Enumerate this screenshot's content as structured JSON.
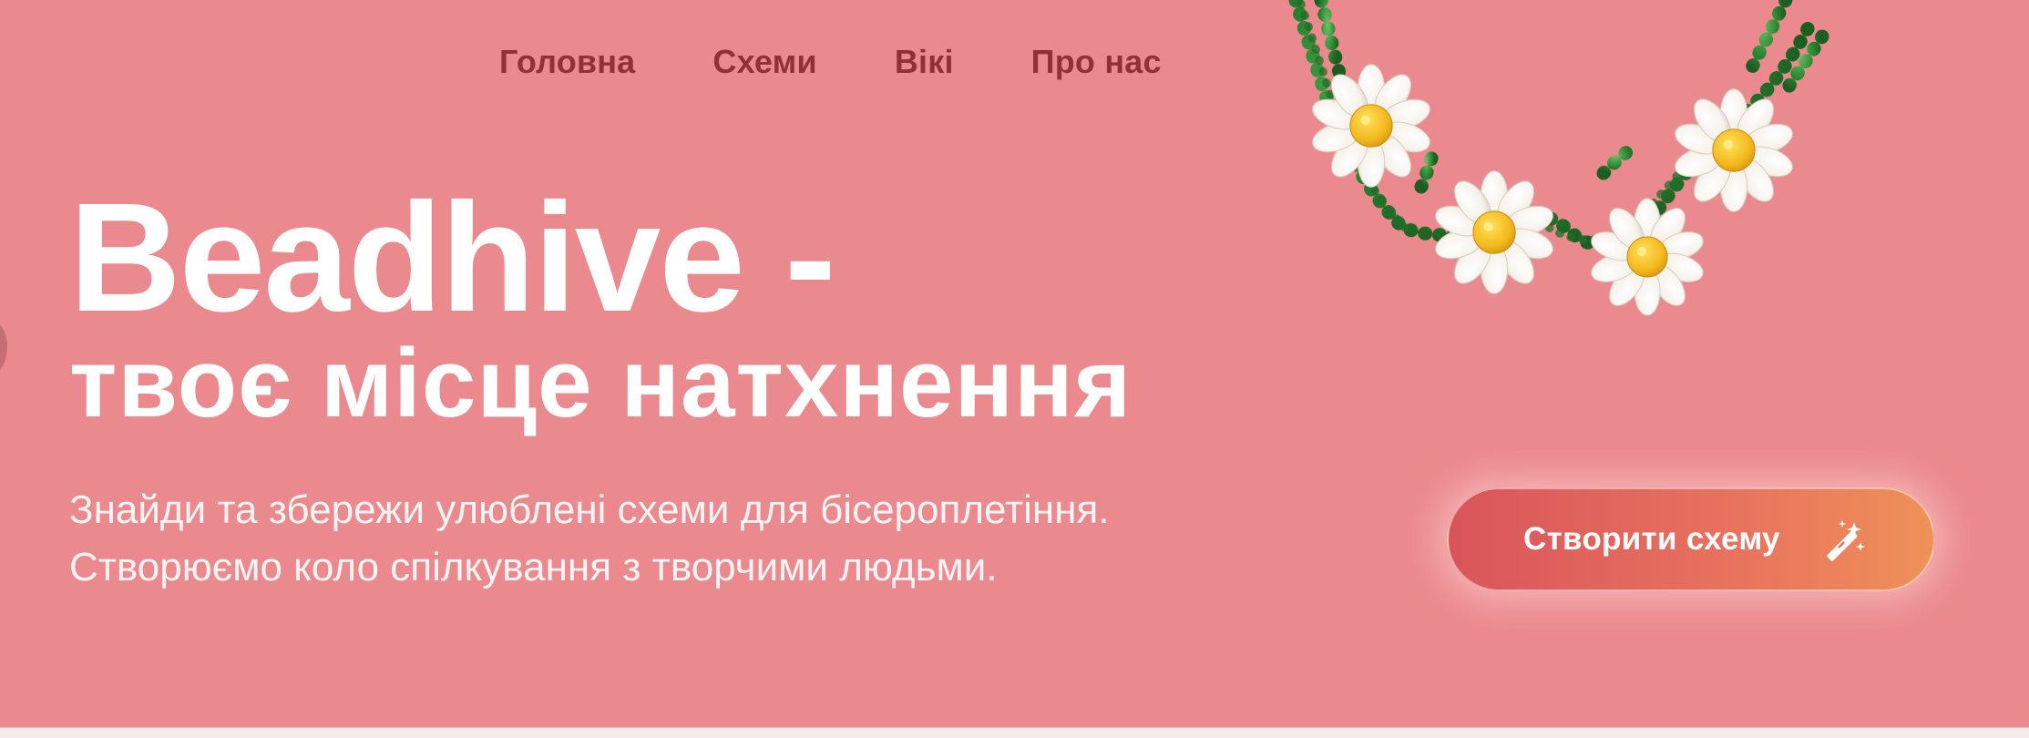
{
  "nav": {
    "items": [
      {
        "label": "Головна"
      },
      {
        "label": "Схеми"
      },
      {
        "label": "Вікі"
      },
      {
        "label": "Про нас"
      }
    ]
  },
  "hero": {
    "title_line1": "Beadhive -",
    "title_line2": "твоє місце натхнення",
    "subtitle_line1": "Знайди та збережи улюблені схеми для бісероплетіння.",
    "subtitle_line2": "Створюємо коло спілкування з творчими людьми.",
    "cta_label": "Створити схему",
    "cta_icon": "magic-wand-icon",
    "decoration_image": "beaded-daisy-necklace"
  },
  "colors": {
    "background": "#eb8a8e",
    "nav_text": "#8f3136",
    "cta_start": "#d9545b",
    "cta_end": "#ef9158"
  }
}
